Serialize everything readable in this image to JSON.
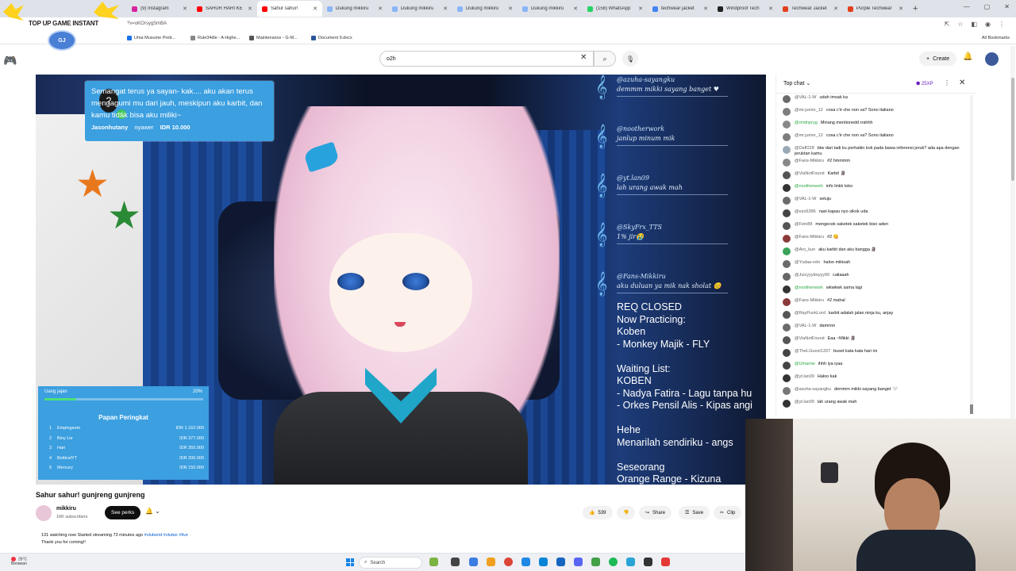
{
  "browser": {
    "tabs": [
      {
        "title": "(9) Instagram",
        "color": "#d6249f"
      },
      {
        "title": "SAHUR HARI KE",
        "color": "#ff0000"
      },
      {
        "title": "Sahur sahur!",
        "color": "#ff0000",
        "active": true
      },
      {
        "title": "Dukung mikkiru",
        "color": "#8ab4f8"
      },
      {
        "title": "Dukung mikkiru",
        "color": "#8ab4f8"
      },
      {
        "title": "Dukung mikkiru",
        "color": "#8ab4f8"
      },
      {
        "title": "Dukung mikkiru",
        "color": "#8ab4f8"
      },
      {
        "title": "(158) WhatsApp",
        "color": "#25d366"
      },
      {
        "title": "techwear jacket",
        "color": "#4285f4"
      },
      {
        "title": "Windproof Tech",
        "color": "#222222"
      },
      {
        "title": "Techwear Jacket",
        "color": "#e2401c"
      },
      {
        "title": "Purple Techwear",
        "color": "#e2401c"
      }
    ],
    "new_tab": "+",
    "url": "?v=oKOrsygSmBA",
    "bookmarks": [
      {
        "label": "Uma Musume Prett...",
        "color": "#1a73e8"
      },
      {
        "label": "Rule34dle - A Highe...",
        "color": "#888888"
      },
      {
        "label": "Maintenance - G-M...",
        "color": "#555555"
      },
      {
        "label": "Document 9.docx",
        "color": "#2b579a"
      }
    ],
    "all_bookmarks": "All Bookmarks"
  },
  "overlay": {
    "topup_title": "TOP UP GAME INSTANT",
    "topup_logo": "GJ"
  },
  "youtube": {
    "search_value": "o2h",
    "create_label": "Create"
  },
  "stream": {
    "donation": {
      "message": "Semangat terus ya sayan- kak.... aku akan terus mengagumi mu dari jauh, meskipun aku karbit, dan kamu tidak bisa aku miliki~",
      "from": "Jasonhutany",
      "verb": "nyawer",
      "amount": "IDR 10.000"
    },
    "overlay_chat": [
      {
        "name": "@azuha-sayangku",
        "msg": "demmm mikki sayang banget ♥"
      },
      {
        "name": "@nootherwork",
        "msg": "janlup minum mik"
      },
      {
        "name": "@yt.lan09",
        "msg": "lah urang awak mah"
      },
      {
        "name": "@SkyFrx_TTS",
        "msg": "1% jir😭"
      },
      {
        "name": "@Fans-Mikkiru",
        "msg": "aku duluan ya mik nak sholat 😊"
      }
    ],
    "request_text": "REQ CLOSED\nNow Practicing:\nKoben\n- Monkey Majik - FLY\n\nWaiting List:\nKOBEN\n- Nadya Fatira - Lagu tanpa hu\n- Orkes Pensil Alis - Kipas angi\n\nHehe\nMenarilah sendiriku - angs\n\nSeseorang\nOrange Range - Kizuna",
    "goal": {
      "label": "Uang jajan",
      "percent_label": "20%",
      "progress": 0.2,
      "leaderboard_title": "Papan Peringkat",
      "rows": [
        {
          "rank": "1",
          "name": "Empingsoto",
          "amount": "IDR 1.162.000"
        },
        {
          "rank": "2",
          "name": "Biny Lie",
          "amount": "IDR 377.000"
        },
        {
          "rank": "3",
          "name": "Hari",
          "amount": "IDR 355.000"
        },
        {
          "rank": "4",
          "name": "BotticelYT",
          "amount": "IDR 200.000"
        },
        {
          "rank": "5",
          "name": "Mercury",
          "amount": "IDR 150.000"
        }
      ]
    }
  },
  "video": {
    "title": "Sahur sahur! gunjreng gunjreng",
    "channel": "mikkiru",
    "subscribers": "16K subscribers",
    "perks_label": "See perks",
    "likes": "539",
    "share": "Share",
    "save": "Save",
    "clip": "Clip",
    "meta": "131 watching now  Started streaming 73 minutes ago",
    "tags": "#vtuberid #vtuber #live",
    "description": "Thank you for coming!!"
  },
  "chat": {
    "header": "Top chat",
    "xp": "25XP",
    "messages": [
      {
        "user": "@VAL-1-W",
        "text": "udah imsak ka",
        "color": "#6b6b6b"
      },
      {
        "user": "@mr.junior_12",
        "text": "cosa c'è che non va? Sono italiano",
        "color": "#7d7d7d"
      },
      {
        "user": "@rmdnpryg",
        "text": "Minang mentionedd rrahhh",
        "color": "#888888",
        "member": true
      },
      {
        "user": "@mr.junior_12",
        "text": "cosa c'è che non va? Sono italiano",
        "color": "#7d7d7d"
      },
      {
        "user": "@Daff228",
        "text": "btw dari tadi ku perhatiin kok pada bawa referensi jeruk? ada apa dengan jeruktan kamu",
        "color": "#9aa9b6"
      },
      {
        "user": "@Fans-Mikkiru",
        "text": "#2  hmmmm",
        "color": "#888888"
      },
      {
        "user": "@ViaNotFound",
        "text": "Karbit 🗿",
        "color": "#555555"
      },
      {
        "user": "@nootherwork",
        "text": "info linkk toko",
        "color": "#333333",
        "member": true
      },
      {
        "user": "@VAL-1-W",
        "text": "setuju",
        "color": "#6b6b6b"
      },
      {
        "user": "@ezo6386",
        "text": "nasi kapau nyo sikok uda",
        "color": "#444444"
      },
      {
        "user": "@Fein88",
        "text": "mengecek saketek saketek biso aden",
        "color": "#555555"
      },
      {
        "user": "@Fans-Mikkiru",
        "text": "#2  😋",
        "color": "#8a3a3a"
      },
      {
        "user": "@Aro_kun",
        "text": "aku karbit dan aku bangga 🗿",
        "color": "#3aa35a"
      },
      {
        "user": "@Yudaa-reto",
        "text": "haloo mikisah",
        "color": "#6b6b6b"
      },
      {
        "user": "@Juicyyyboyyy99",
        "text": "caliaaah",
        "color": "#666666"
      },
      {
        "user": "@nootherwork",
        "text": "wkwkwk sama lagi",
        "color": "#333333",
        "member": true
      },
      {
        "user": "@Fans-Mikkiru",
        "text": "#2  mahal",
        "color": "#8a3a3a"
      },
      {
        "user": "@RayPunkLord",
        "text": "karbit adalah jalan ninja ku, anjay",
        "color": "#555555"
      },
      {
        "user": "@VAL-1-W",
        "text": "damnnn",
        "color": "#6b6b6b"
      },
      {
        "user": "@ViaNotFound",
        "text": "Eaa ~Mikki 🗿",
        "color": "#555555"
      },
      {
        "user": "@TheLGuest1337",
        "text": "buset kata kata hari ini",
        "color": "#444444"
      },
      {
        "user": "@Umamw",
        "text": "ihhh iya iyaa",
        "color": "#444444",
        "member": true
      },
      {
        "user": "@yt.lan09",
        "text": "Haloo kak",
        "color": "#333333"
      },
      {
        "user": "@azuha-sayangku",
        "text": "demmm mikki sayang banget 🤍",
        "color": "#777777"
      },
      {
        "user": "@yt.lan09",
        "text": "lah urang awak mah",
        "color": "#333333"
      }
    ]
  },
  "taskbar": {
    "weather_temp": "26°C",
    "weather_desc": "Berawan",
    "search_label": "Search"
  }
}
